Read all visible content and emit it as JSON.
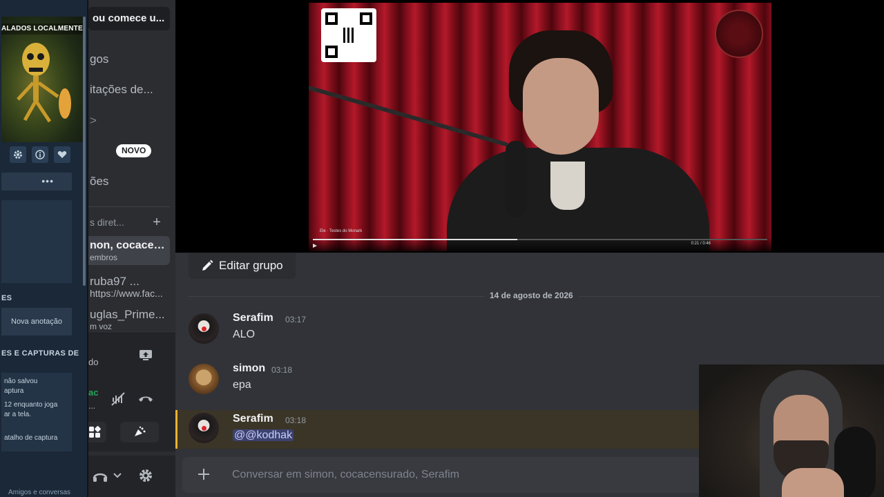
{
  "overlay": {
    "game_label": "ALADOS LOCALMENTE",
    "section_notes": "ES",
    "new_note_label": "Nova anotação",
    "section_screenshots": "ES E CAPTURAS DE",
    "capture_text_1": "não salvou",
    "capture_text_2": "aptura",
    "capture_text_3": "12 enquanto joga",
    "capture_text_4": "ar a tela.",
    "capture_text_5": "atalho de captura",
    "bottom_label": "Amigos e conversas"
  },
  "sidebar": {
    "search_text": "ou comece u...",
    "nav_1": "gos",
    "nav_2": "itações de...",
    "nav_3": ">",
    "new_badge": "NOVO",
    "nav_4": "ões",
    "dm_header": "s diret...",
    "dm_plus": "+",
    "dms": [
      {
        "name": "non, cocacen...",
        "sub": "embros"
      },
      {
        "name": "ruba97 ...",
        "sub": "https://www.fac..."
      },
      {
        "name": "uglas_Prime...",
        "sub": "m voz"
      }
    ],
    "voice_status": "do",
    "voice_green": "ac",
    "voice_sub": "..."
  },
  "video": {
    "player_time": "0:21 / 0:46",
    "player_title": "Ele  ·  Testes do Monark",
    "progress_fraction": 0.45
  },
  "chat": {
    "edit_group_label": "Editar grupo",
    "date_separator": "14 de agosto de 2026",
    "messages": [
      {
        "author": "Serafim",
        "time": "03:17",
        "text": "ALO"
      },
      {
        "author": "simon",
        "time": "03:18",
        "text": "epa"
      },
      {
        "author": "Serafim",
        "time": "03:18",
        "text": "@@kodhak"
      }
    ],
    "composer_placeholder": "Conversar em simon, cocacensurado, Serafim",
    "composer_plus": "+"
  },
  "colors": {
    "accent_mention_bg": "#3c4270",
    "highlight_border": "#f0b232",
    "online_green": "#23a559"
  },
  "icons": [
    "settings-icon",
    "info-icon",
    "heart-icon",
    "screen-share-icon",
    "mute-icon",
    "hang-up-icon",
    "activities-icon",
    "soundboard-icon",
    "headphones-icon",
    "chevron-down-icon",
    "gear-icon",
    "pencil-icon",
    "plus-icon"
  ]
}
